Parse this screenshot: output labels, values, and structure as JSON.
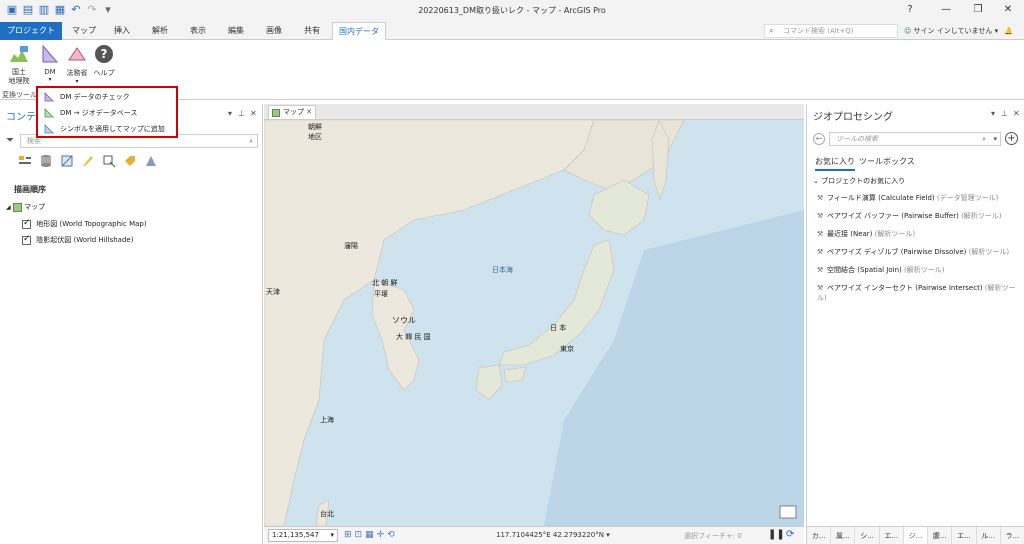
{
  "window": {
    "title": "20220613_DM取り扱いレク - マップ - ArcGIS Pro",
    "help": "?",
    "minimize": "—",
    "maximize": "❐",
    "close": "✕"
  },
  "tabs": [
    "プロジェクト",
    "マップ",
    "挿入",
    "解析",
    "表示",
    "編集",
    "画像",
    "共有",
    "国内データ"
  ],
  "command_search": {
    "placeholder": "コマンド検索 (Alt+Q)"
  },
  "signin": "サイン インしていません",
  "ribbon": {
    "buttons": [
      {
        "label": "国土\n地理院"
      },
      {
        "label": "DM"
      },
      {
        "label": "法務省"
      },
      {
        "label": "ヘルプ"
      }
    ],
    "group_label": "変換ツール"
  },
  "dropdown": {
    "items": [
      "DM データのチェック",
      "DM → ジオデータベース",
      "シンボルを適用してマップに追加"
    ]
  },
  "contents": {
    "title": "コンテンツ",
    "search_placeholder": "検索",
    "drawing_order": "描画順序",
    "map_name": "マップ",
    "layers": [
      "地形図 (World Topographic Map)",
      "陰影起伏図 (World Hillshade)"
    ]
  },
  "map": {
    "tab_label": "マップ",
    "labels": {
      "shenyang": "瀋陽",
      "nk": "北 朝 鮮",
      "pyongyang": "平壌",
      "seoul": "ソウル",
      "korea": "大 韓 民 国",
      "tianjin": "天津",
      "shanghai": "上海",
      "taipei": "台北",
      "sea_of_japan": "日本海",
      "japan": "日 本",
      "tokyo": "東京",
      "district": "朝鮮\n地区"
    },
    "scale": "1:21,135,547",
    "coordinates": "117.7104425°E 42.2793220°N",
    "selected_features": "選択フィーチャ: 0"
  },
  "geoprocessing": {
    "title": "ジオプロセシング",
    "search_placeholder": "ツールの検索",
    "tabs": [
      "お気に入り",
      "ツールボックス"
    ],
    "group": "プロジェクトのお気に入り",
    "tools": [
      {
        "name": "フィールド演算 (Calculate Field)",
        "category": "(データ管理ツール)"
      },
      {
        "name": "ペアワイズ バッファー (Pairwise Buffer)",
        "category": "(解析ツール)"
      },
      {
        "name": "最近接 (Near)",
        "category": "(解析ツール)"
      },
      {
        "name": "ペアワイズ ディゾルブ (Pairwise Dissolve)",
        "category": "(解析ツール)"
      },
      {
        "name": "空間結合 (Spatial Join)",
        "category": "(解析ツール)"
      },
      {
        "name": "ペアワイズ インターセクト (Pairwise Intersect)",
        "category": "(解析ツール)"
      }
    ],
    "bottom_tabs": [
      "カ...",
      "属...",
      "シ...",
      "エ...",
      "ジ...",
      "腹...",
      "エ...",
      "ル...",
      "ラ..."
    ]
  }
}
